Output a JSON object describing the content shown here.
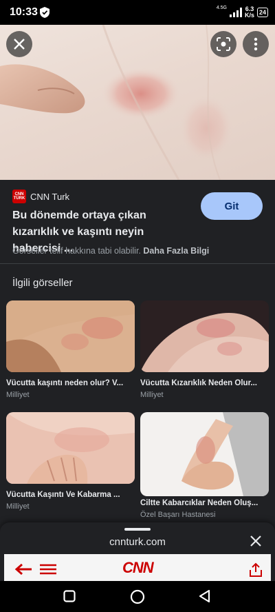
{
  "status_bar": {
    "time": "10:33",
    "network_type": "4.5G",
    "speed_value": "6.3",
    "speed_unit": "K/s",
    "battery": "24"
  },
  "hero": {
    "close_icon": "close-icon",
    "lens_icon": "lens-icon",
    "menu_icon": "more-vert-icon"
  },
  "source": {
    "logo_text": "CNN TÜRK",
    "name": "CNN Turk",
    "headline": "Bu dönemde ortaya çıkan kızarıklık ve kaşıntı neyin habercisi ...",
    "visit_label": "Git",
    "copyright_text": "Görseller telif hakkına tabi olabilir.",
    "more_info_label": "Daha Fazla Bilgi"
  },
  "related": {
    "title": "İlgili görseller",
    "items": [
      {
        "title": "Vücutta kaşıntı neden olur? V...",
        "source": "Milliyet"
      },
      {
        "title": "Vücutta Kızarıklık Neden Olur...",
        "source": "Milliyet"
      },
      {
        "title": "Vücutta Kaşıntı Ve Kabarma ...",
        "source": "Milliyet"
      },
      {
        "title": "Ciltte Kabarcıklar Neden Oluş...",
        "source": "Özel Başarı Hastanesi"
      }
    ]
  },
  "sheet": {
    "domain": "cnnturk.com",
    "preview_logo": "CNN"
  },
  "colors": {
    "accent_button": "#a8c7fa",
    "background": "#202124",
    "brand_red": "#cc0000"
  }
}
